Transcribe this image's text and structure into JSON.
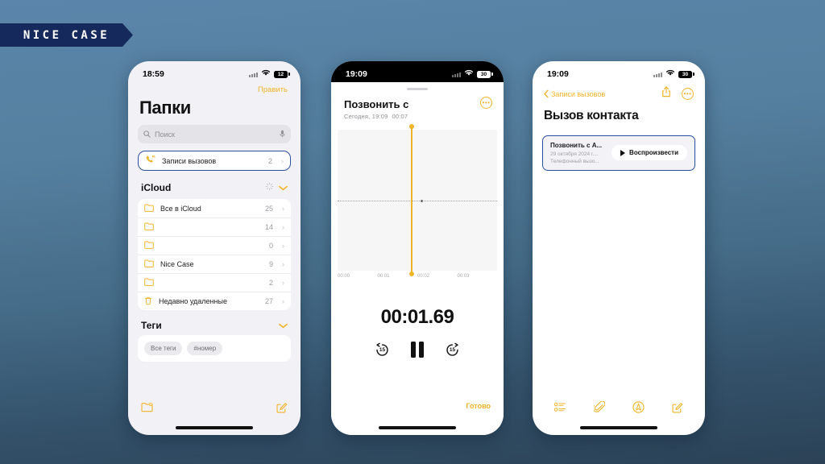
{
  "brand": {
    "name": "NICE CASE"
  },
  "colors": {
    "accent": "#f0b429",
    "selection": "#2b4f9e",
    "background_top": "#5b85aa",
    "background_bottom": "#2b4256"
  },
  "screen1": {
    "status": {
      "time": "18:59",
      "battery": "12"
    },
    "edit_label": "Править",
    "title": "Папки",
    "search": {
      "placeholder": "Поиск",
      "icon": "search-icon",
      "mic_icon": "microphone-icon"
    },
    "pinned_row": {
      "label": "Записи вызовов",
      "count": "2",
      "icon": "phone-recording-icon"
    },
    "section_icloud": {
      "title": "iCloud",
      "sync_icon": "sync-spinner-icon",
      "collapse_icon": "chevron-down-icon"
    },
    "folders": [
      {
        "label": "Все в iCloud",
        "count": "25",
        "icon": "folder-icon"
      },
      {
        "label": "",
        "count": "14",
        "icon": "folder-icon"
      },
      {
        "label": "",
        "count": "0",
        "icon": "folder-icon"
      },
      {
        "label": "Nice Case",
        "count": "9",
        "icon": "folder-icon"
      },
      {
        "label": "",
        "count": "2",
        "icon": "folder-icon"
      },
      {
        "label": "Недавно удаленные",
        "count": "27",
        "icon": "trash-icon"
      }
    ],
    "section_tags": {
      "title": "Теги",
      "collapse_icon": "chevron-down-icon"
    },
    "tags": [
      "Все теги",
      "#номер"
    ],
    "toolbar": {
      "new_folder_icon": "new-folder-icon",
      "compose_icon": "compose-icon"
    }
  },
  "screen2": {
    "status": {
      "time": "19:09",
      "battery": "30"
    },
    "title": "Позвонить с",
    "subtitle_date": "Сегодня, 19:09",
    "subtitle_duration": "00:07",
    "more_icon": "more-ellipsis-icon",
    "ticks": [
      "00:00",
      "00:01",
      "00:02",
      "00:03"
    ],
    "current_time": "00:01.69",
    "controls": {
      "back15": "15",
      "pause_icon": "pause-icon",
      "forward15": "15"
    },
    "done_label": "Готово"
  },
  "screen3": {
    "status": {
      "time": "19:09",
      "battery": "30"
    },
    "back_label": "Записи вызовов",
    "share_icon": "share-icon",
    "more_icon": "more-ellipsis-icon",
    "title": "Вызов контакта",
    "attachment": {
      "name": "Позвонить с А...",
      "date": "29 октября 2024 г....",
      "kind": "Телефонный вызо...",
      "play_label": "Воспроизвести",
      "play_icon": "play-icon"
    },
    "toolbar": {
      "checklist_icon": "checklist-icon",
      "attach_icon": "paperclip-icon",
      "markup_icon": "markup-pen-icon",
      "compose_icon": "compose-icon"
    }
  },
  "chart_data": {
    "type": "area",
    "title": "Audio waveform scrubber",
    "xlabel": "",
    "ylabel": "",
    "x": [
      "00:00",
      "00:01",
      "00:02",
      "00:03"
    ],
    "values": [
      0,
      0,
      0,
      0
    ],
    "annotations": [
      {
        "label": "playhead",
        "x": "00:01.69"
      }
    ],
    "grid": false,
    "legend": "none"
  }
}
